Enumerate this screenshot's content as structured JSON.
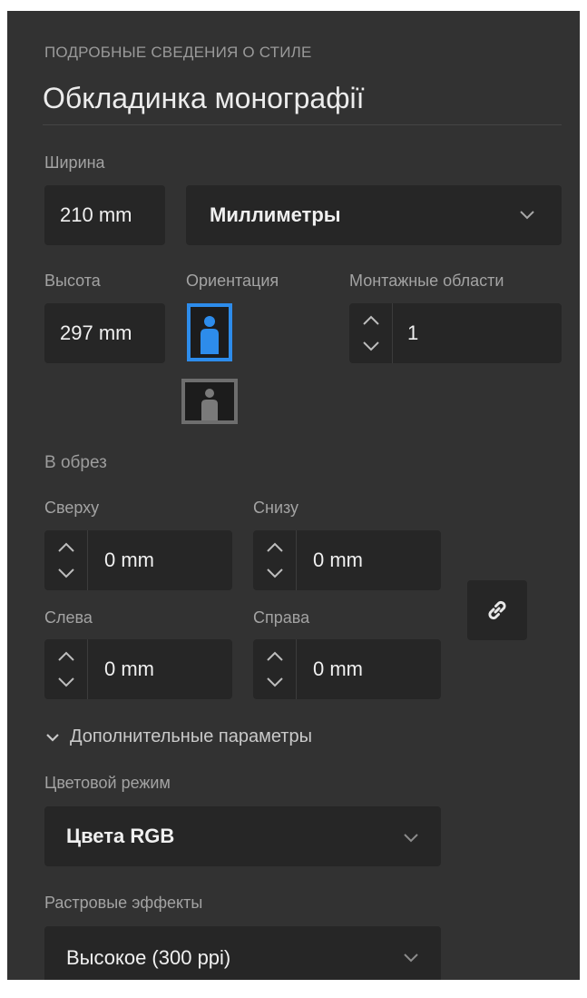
{
  "header": {
    "eyebrow": "ПОДРОБНЫЕ СВЕДЕНИЯ О СТИЛЕ",
    "title": "Обкладинка монографії"
  },
  "size": {
    "width_label": "Ширина",
    "width_value": "210 mm",
    "units_value": "Миллиметры",
    "height_label": "Высота",
    "height_value": "297 mm",
    "orientation_label": "Ориентация",
    "orientation_selected": "portrait",
    "artboards_label": "Монтажные области",
    "artboards_value": "1"
  },
  "bleed": {
    "section_label": "В обрез",
    "top_label": "Сверху",
    "top_value": "0 mm",
    "bottom_label": "Снизу",
    "bottom_value": "0 mm",
    "left_label": "Слева",
    "left_value": "0 mm",
    "right_label": "Справа",
    "right_value": "0 mm",
    "link_icon": "link-icon"
  },
  "advanced": {
    "toggle_label": "Дополнительные параметры",
    "color_mode_label": "Цветовой режим",
    "color_mode_value": "Цвета RGB",
    "raster_label": "Растровые эффекты",
    "raster_value": "Высокое (300 ppi)"
  },
  "colors": {
    "panel_bg": "#323232",
    "field_bg": "#262626",
    "accent": "#2d8ceb"
  }
}
